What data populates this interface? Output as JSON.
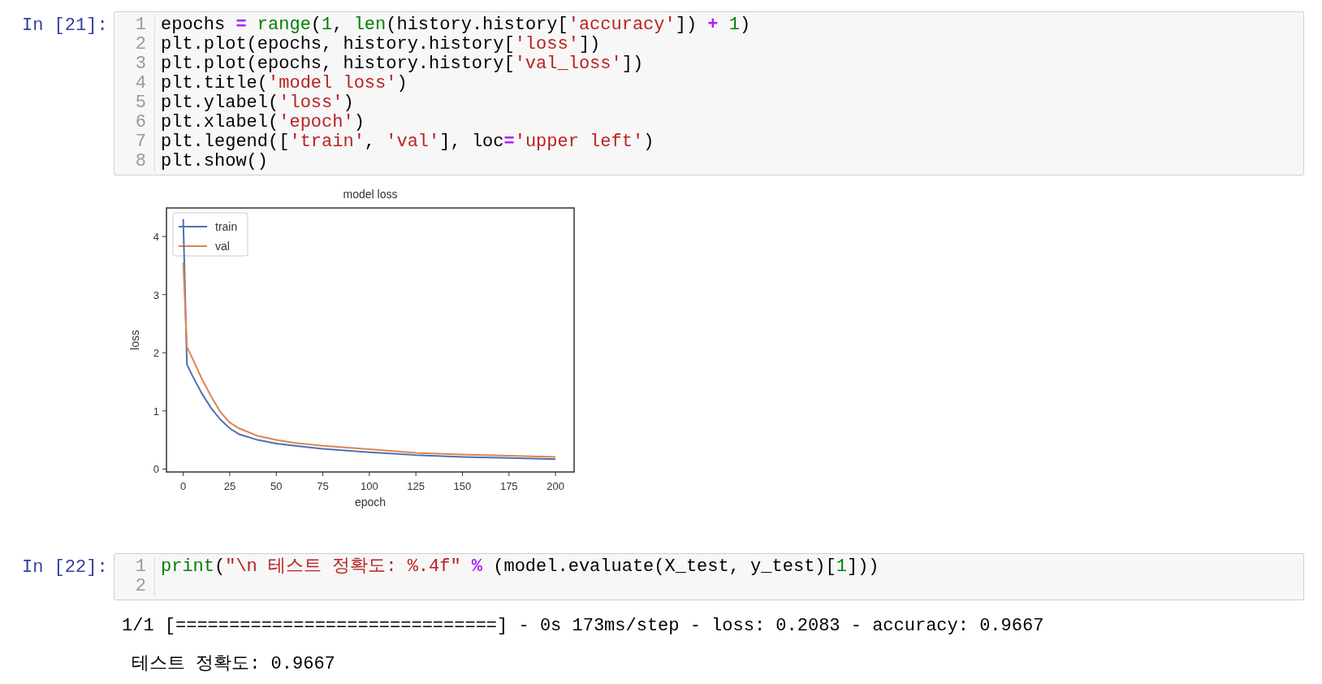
{
  "cells": [
    {
      "prompt": "In [21]:",
      "lines": [
        {
          "number": "1",
          "tokens": [
            {
              "kind": "text",
              "text": "epochs "
            },
            {
              "kind": "op",
              "text": "= "
            },
            {
              "kind": "builtin",
              "text": "range"
            },
            {
              "kind": "text",
              "text": "("
            },
            {
              "kind": "number",
              "text": "1"
            },
            {
              "kind": "text",
              "text": ", "
            },
            {
              "kind": "builtin",
              "text": "len"
            },
            {
              "kind": "text",
              "text": "(history.history["
            },
            {
              "kind": "string",
              "text": "'accuracy'"
            },
            {
              "kind": "text",
              "text": "]) "
            },
            {
              "kind": "op",
              "text": "+ "
            },
            {
              "kind": "number",
              "text": "1"
            },
            {
              "kind": "text",
              "text": ")"
            }
          ]
        },
        {
          "number": "2",
          "tokens": [
            {
              "kind": "text",
              "text": "plt.plot(epochs, history.history["
            },
            {
              "kind": "string",
              "text": "'loss'"
            },
            {
              "kind": "text",
              "text": "])"
            }
          ]
        },
        {
          "number": "3",
          "tokens": [
            {
              "kind": "text",
              "text": "plt.plot(epochs, history.history["
            },
            {
              "kind": "string",
              "text": "'val_loss'"
            },
            {
              "kind": "text",
              "text": "])"
            }
          ]
        },
        {
          "number": "4",
          "tokens": [
            {
              "kind": "text",
              "text": "plt.title("
            },
            {
              "kind": "string",
              "text": "'model loss'"
            },
            {
              "kind": "text",
              "text": ")"
            }
          ]
        },
        {
          "number": "5",
          "tokens": [
            {
              "kind": "text",
              "text": "plt.ylabel("
            },
            {
              "kind": "string",
              "text": "'loss'"
            },
            {
              "kind": "text",
              "text": ")"
            }
          ]
        },
        {
          "number": "6",
          "tokens": [
            {
              "kind": "text",
              "text": "plt.xlabel("
            },
            {
              "kind": "string",
              "text": "'epoch'"
            },
            {
              "kind": "text",
              "text": ")"
            }
          ]
        },
        {
          "number": "7",
          "tokens": [
            {
              "kind": "text",
              "text": "plt.legend(["
            },
            {
              "kind": "string",
              "text": "'train'"
            },
            {
              "kind": "text",
              "text": ", "
            },
            {
              "kind": "string",
              "text": "'val'"
            },
            {
              "kind": "text",
              "text": "], loc"
            },
            {
              "kind": "op",
              "text": "="
            },
            {
              "kind": "string",
              "text": "'upper left'"
            },
            {
              "kind": "text",
              "text": ")"
            }
          ]
        },
        {
          "number": "8",
          "tokens": [
            {
              "kind": "text",
              "text": "plt.show()"
            }
          ]
        }
      ],
      "output": {
        "kind": "chart",
        "chart_data": {
          "type": "line",
          "title": "model loss",
          "xlabel": "epoch",
          "ylabel": "loss",
          "x": [
            0,
            2,
            5,
            10,
            15,
            20,
            25,
            30,
            40,
            50,
            60,
            75,
            100,
            125,
            150,
            175,
            200
          ],
          "series": [
            {
              "name": "train",
              "color": "#4c72b0",
              "values": [
                4.3,
                1.8,
                1.6,
                1.3,
                1.05,
                0.85,
                0.7,
                0.6,
                0.5,
                0.44,
                0.4,
                0.35,
                0.29,
                0.24,
                0.21,
                0.19,
                0.17
              ]
            },
            {
              "name": "val",
              "color": "#dd8452",
              "values": [
                3.55,
                2.1,
                1.9,
                1.55,
                1.25,
                0.98,
                0.8,
                0.7,
                0.57,
                0.5,
                0.45,
                0.4,
                0.34,
                0.28,
                0.25,
                0.23,
                0.21
              ]
            }
          ],
          "legend": true,
          "xlim": [
            -9,
            210
          ],
          "ylim": [
            -0.05,
            4.49
          ],
          "xticks": [
            0,
            25,
            50,
            75,
            100,
            125,
            150,
            175,
            200
          ],
          "yticks": [
            0,
            1,
            2,
            3,
            4
          ]
        }
      }
    },
    {
      "prompt": "In [22]:",
      "lines": [
        {
          "number": "1",
          "tokens": [
            {
              "kind": "builtin",
              "text": "print"
            },
            {
              "kind": "text",
              "text": "("
            },
            {
              "kind": "string",
              "text": "\"\\n 테스트 정확도: %.4f\""
            },
            {
              "kind": "op",
              "text": " %"
            },
            {
              "kind": "text",
              "text": " (model.evaluate(X_test, y_test)["
            },
            {
              "kind": "number",
              "text": "1"
            },
            {
              "kind": "text",
              "text": "]))"
            }
          ]
        },
        {
          "number": "2"
        }
      ],
      "output": {
        "kind": "stream",
        "lines": [
          "1/1 [==============================] - 0s 173ms/step - loss: 0.2083 - accuracy: 0.9667",
          "테스트 정확도: 0.9667"
        ]
      }
    }
  ]
}
